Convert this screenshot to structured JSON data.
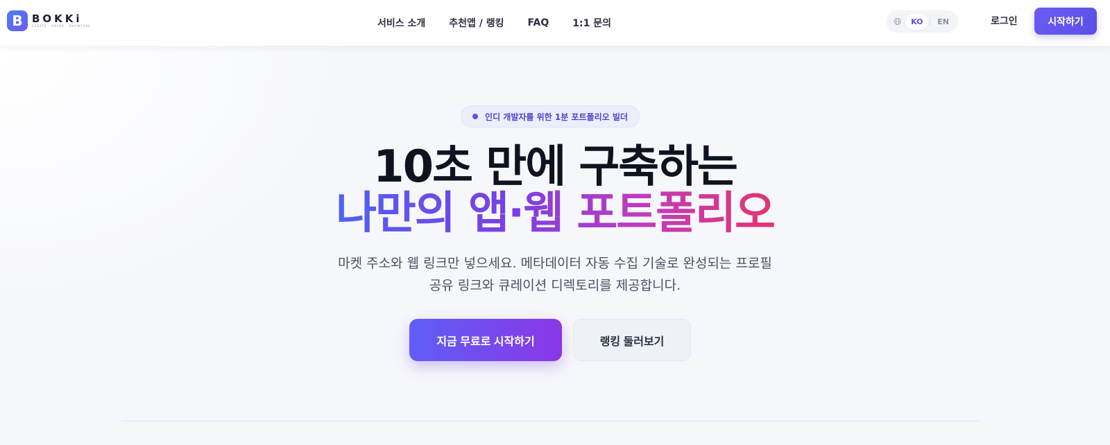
{
  "header": {
    "logo": {
      "word": "BOKKi",
      "tagline": "CREATE · SHARE · SHOWCASE",
      "mark": "B"
    },
    "nav": [
      {
        "label": "서비스 소개"
      },
      {
        "label": "추천앱 / 랭킹"
      },
      {
        "label": "FAQ"
      },
      {
        "label": "1:1 문의"
      }
    ],
    "language": {
      "options": [
        "KO",
        "EN"
      ],
      "selected": "KO"
    },
    "login_label": "로그인",
    "start_label": "시작하기"
  },
  "hero": {
    "badge": "인디 개발자를 위한 1분 포트폴리오 빌더",
    "headline_line1": "10초 만에 구축하는",
    "headline_line2": "나만의 앱·웹 포트폴리오",
    "subtext_line1": "마켓 주소와 웹 링크만 넣으세요. 메타데이터 자동 수집 기술로 완성되는 프로필",
    "subtext_line2": "공유 링크와 큐레이션 디렉토리를 제공합니다.",
    "cta_primary": "지금 무료로 시작하기",
    "cta_secondary": "랭킹 둘러보기"
  },
  "colors": {
    "accent": "#5b4fe6",
    "gradient_start": "#4f63f0",
    "gradient_end": "#e2356f"
  }
}
